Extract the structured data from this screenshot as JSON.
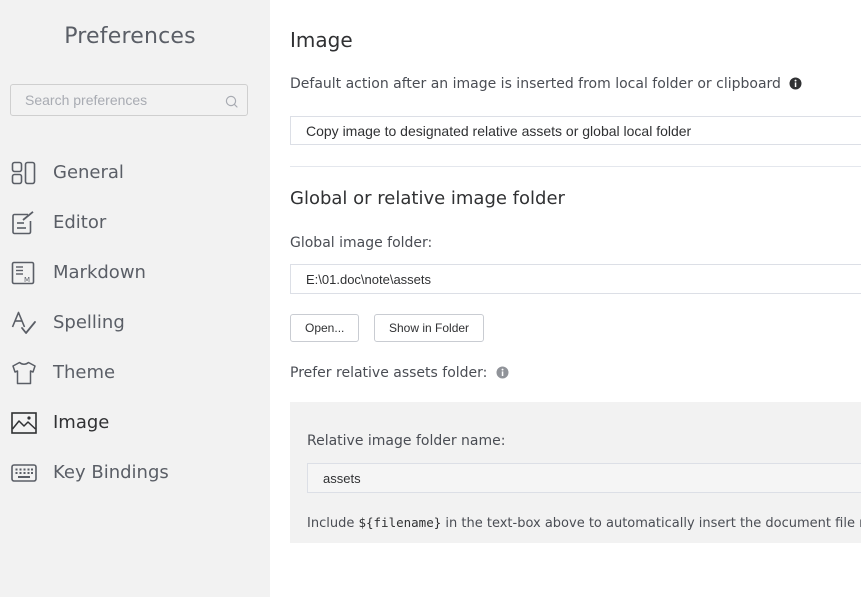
{
  "sidebar": {
    "title": "Preferences",
    "search": {
      "placeholder": "Search preferences",
      "value": ""
    },
    "items": [
      {
        "label": "General",
        "icon": "general-icon",
        "active": false
      },
      {
        "label": "Editor",
        "icon": "editor-icon",
        "active": false
      },
      {
        "label": "Markdown",
        "icon": "markdown-icon",
        "active": false
      },
      {
        "label": "Spelling",
        "icon": "spelling-icon",
        "active": false
      },
      {
        "label": "Theme",
        "icon": "theme-icon",
        "active": false
      },
      {
        "label": "Image",
        "icon": "image-icon",
        "active": true
      },
      {
        "label": "Key Bindings",
        "icon": "keyboard-icon",
        "active": false
      }
    ]
  },
  "main": {
    "image_section": {
      "title": "Image",
      "default_action_label": "Default action after an image is inserted from local folder or clipboard",
      "default_action_value": "Copy image to designated relative assets or global local folder"
    },
    "folder_section": {
      "title": "Global or relative image folder",
      "global_folder_label": "Global image folder:",
      "global_folder_value": "E:\\01.doc\\note\\assets",
      "open_button": "Open...",
      "show_in_folder_button": "Show in Folder",
      "prefer_relative_label": "Prefer relative assets folder:",
      "relative_folder_label": "Relative image folder name:",
      "relative_folder_value": "assets",
      "hint_prefix": "Include ",
      "hint_code": "${filename}",
      "hint_suffix": " in the text-box above to automatically insert the document file name."
    }
  },
  "colors": {
    "sidebar_bg": "#f2f2f2",
    "text": "#303133",
    "muted_text": "#5a5e66",
    "border": "#dcdfe6"
  }
}
